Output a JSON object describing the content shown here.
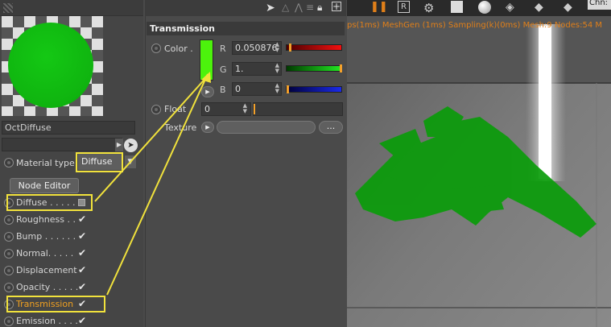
{
  "material_editor": {
    "name": "OctDiffuse",
    "material_type_label": "Material type",
    "material_type_value": "Diffuse",
    "node_editor_label": "Node Editor",
    "channels": [
      {
        "label": "Diffuse . . . . .",
        "state": "square",
        "highlight": true
      },
      {
        "label": "Roughness . .",
        "state": "check"
      },
      {
        "label": "Bump . . . . . .",
        "state": "check"
      },
      {
        "label": "Normal. . . . .",
        "state": "check"
      },
      {
        "label": "Displacement",
        "state": "check"
      },
      {
        "label": "Opacity . . . . .",
        "state": "check"
      },
      {
        "label": "Transmission",
        "state": "check",
        "highlight": true,
        "active": true
      },
      {
        "label": "Emission . . . .",
        "state": "check"
      }
    ]
  },
  "transmission": {
    "title": "Transmission",
    "color_label": "Color .",
    "swatch_color": "#4cf20c",
    "r_label": "R",
    "r_value": "0.050876",
    "g_label": "G",
    "g_value": "1.",
    "b_label": "B",
    "b_value": "0",
    "r_level": 0.05,
    "g_level": 1.0,
    "b_level": 0.0,
    "float_label": "Float .",
    "float_value": "0",
    "float_level": 0.0,
    "texture_label": "Texture",
    "texture_more": "..."
  },
  "viewport": {
    "info_text": "ps(1ms) MeshGen (1ms) Sampling(k)(0ms) Mesh:9 Nodes:54 M",
    "corner_text": "Chn:",
    "object_color": "#0a9c0a"
  },
  "icons": {
    "grip": "grip-icon",
    "picker": "picker-icon",
    "arrow": "arrow-left-icon",
    "lock": "lock-icon",
    "add": "add-icon"
  },
  "accent": "#f1e23c"
}
